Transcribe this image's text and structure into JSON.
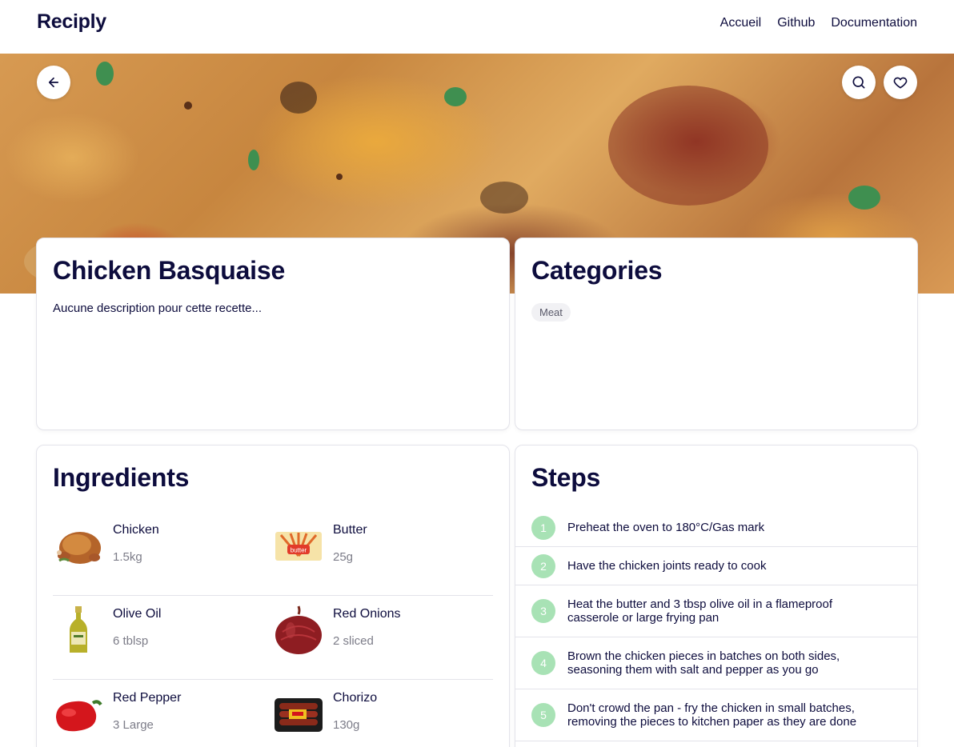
{
  "nav": {
    "brand": "Reciply",
    "links": [
      "Accueil",
      "Github",
      "Documentation"
    ]
  },
  "hero": {
    "back_icon": "arrow-left-icon",
    "search_icon": "search-icon",
    "favorite_icon": "heart-icon"
  },
  "recipe": {
    "title": "Chicken Basquaise",
    "description": "Aucune description pour cette recette..."
  },
  "categories": {
    "heading": "Categories",
    "tags": [
      "Meat"
    ]
  },
  "ingredients": {
    "heading": "Ingredients",
    "items": [
      {
        "name": "Chicken",
        "qty": "1.5kg"
      },
      {
        "name": "Butter",
        "qty": "25g"
      },
      {
        "name": "Olive Oil",
        "qty": "6 tblsp"
      },
      {
        "name": "Red Onions",
        "qty": "2 sliced"
      },
      {
        "name": "Red Pepper",
        "qty": "3 Large"
      },
      {
        "name": "Chorizo",
        "qty": "130g"
      }
    ],
    "butter_label": "butter"
  },
  "steps": {
    "heading": "Steps",
    "items": [
      {
        "n": "1",
        "text": "Preheat the oven to 180°C/Gas mark"
      },
      {
        "n": "2",
        "text": "Have the chicken joints ready to cook"
      },
      {
        "n": "3",
        "text": "Heat the butter and 3 tbsp olive oil in a flameproof casserole or large frying pan"
      },
      {
        "n": "4",
        "text": "Brown the chicken pieces in batches on both sides, seasoning them with salt and pepper as you go"
      },
      {
        "n": "5",
        "text": "Don't crowd the pan - fry the chicken in small batches, removing the pieces to kitchen paper as they are done"
      }
    ]
  },
  "colors": {
    "primary_text": "#0d0c3d",
    "muted_text": "#7c7c88",
    "step_badge": "#a8e2b5",
    "border": "#e3e3ea"
  }
}
